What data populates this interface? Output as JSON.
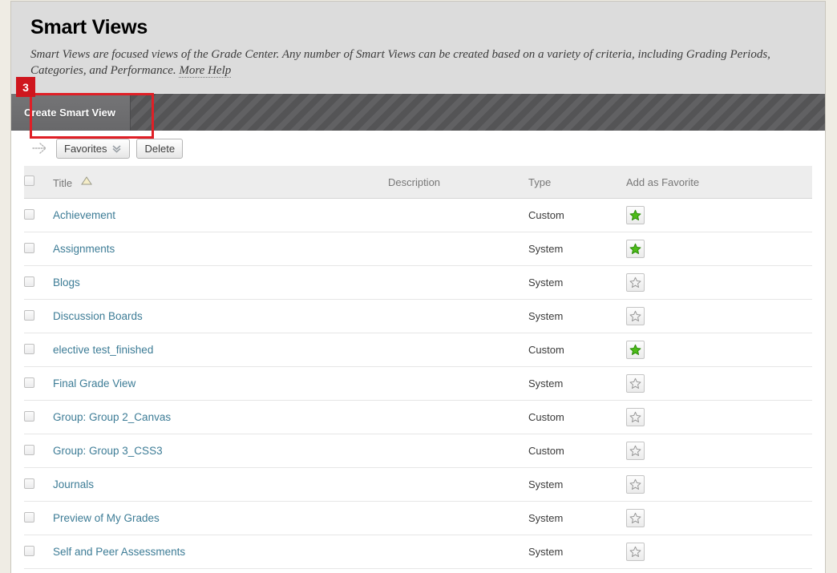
{
  "page": {
    "title": "Smart Views",
    "instructions": "Smart Views are focused views of the Grade Center. Any number of Smart Views can be created based on a variety of criteria, including Grading Periods, Categories, and Performance.",
    "more_help_label": "More Help"
  },
  "annotation": {
    "step_number": "3",
    "target": "create-smart-view-button",
    "color": "#cf161e"
  },
  "action_bar": {
    "create_button_label": "Create Smart View"
  },
  "list_controls": {
    "flow_icon": "dotted-arrow-icon",
    "favorites_label": "Favorites",
    "favorites_chevron_icon": "double-chevron-down-icon",
    "delete_label": "Delete"
  },
  "table": {
    "columns": [
      {
        "key": "check",
        "label": ""
      },
      {
        "key": "title",
        "label": "Title",
        "sorted": true,
        "sort_icon": "sort-ascending-triangle-icon"
      },
      {
        "key": "description",
        "label": "Description"
      },
      {
        "key": "type",
        "label": "Type"
      },
      {
        "key": "favorite",
        "label": "Add as Favorite"
      }
    ],
    "select_all_checked": false,
    "rows": [
      {
        "title": "Achievement",
        "description": "",
        "type": "Custom",
        "favorite": true
      },
      {
        "title": "Assignments",
        "description": "",
        "type": "System",
        "favorite": true
      },
      {
        "title": "Blogs",
        "description": "",
        "type": "System",
        "favorite": false
      },
      {
        "title": "Discussion Boards",
        "description": "",
        "type": "System",
        "favorite": false
      },
      {
        "title": "elective test_finished",
        "description": "",
        "type": "Custom",
        "favorite": true
      },
      {
        "title": "Final Grade View",
        "description": "",
        "type": "System",
        "favorite": false
      },
      {
        "title": "Group: Group 2_Canvas",
        "description": "",
        "type": "Custom",
        "favorite": false
      },
      {
        "title": "Group: Group 3_CSS3",
        "description": "",
        "type": "Custom",
        "favorite": false
      },
      {
        "title": "Journals",
        "description": "",
        "type": "System",
        "favorite": false
      },
      {
        "title": "Preview of My Grades",
        "description": "",
        "type": "System",
        "favorite": false
      },
      {
        "title": "Self and Peer Assessments",
        "description": "",
        "type": "System",
        "favorite": false
      }
    ]
  },
  "colors": {
    "link": "#3d7c96",
    "favorite_star_on": "#4cbb17",
    "favorite_star_off": "#9a9a9a",
    "annotation": "#cf161e",
    "header_band": "#dcdcdc",
    "action_bar": "#58585a"
  }
}
